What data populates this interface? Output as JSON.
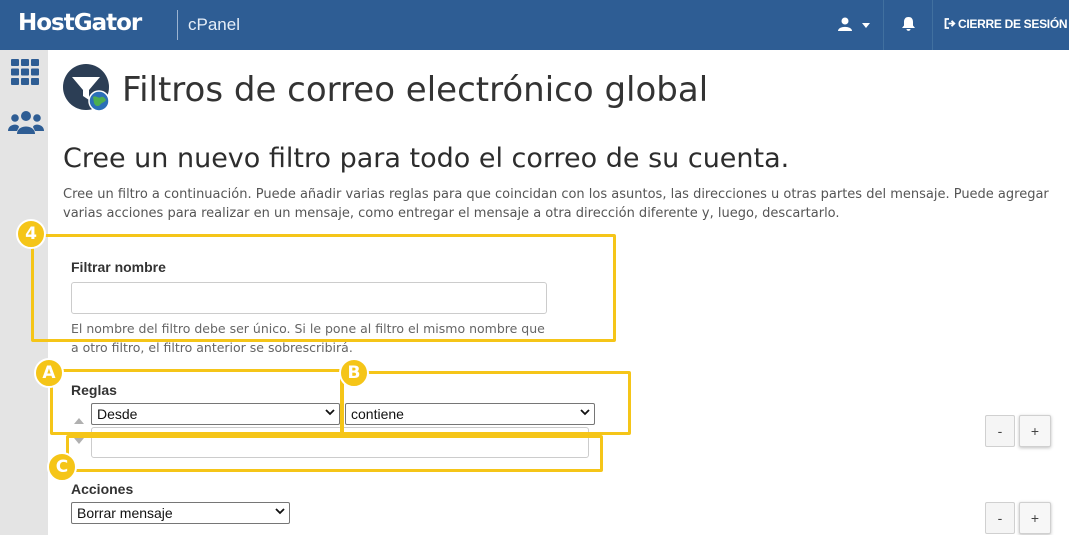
{
  "header": {
    "logo": "HostGator",
    "product": "cPanel",
    "logout_label": "CIERRE DE SESIÓN"
  },
  "icons": {
    "sidebar": [
      "grid-icon",
      "users-icon"
    ],
    "page": "filter-globe-icon",
    "header": [
      "user-icon",
      "chevron-down-icon",
      "bell-icon",
      "logout-icon"
    ]
  },
  "page": {
    "title": "Filtros de correo electrónico global",
    "section_title": "Cree un nuevo filtro para todo el correo de su cuenta.",
    "description": "Cree un filtro a continuación. Puede añadir varias reglas para que coincidan con los asuntos, las direcciones u otras partes del mensaje. Puede agregar varias acciones para realizar en un mensaje, como entregar el mensaje a otra dirección diferente y, luego, descartarlo."
  },
  "form": {
    "filter_name_label": "Filtrar nombre",
    "filter_name_value": "",
    "filter_name_help": "El nombre del filtro debe ser único. Si le pone al filtro el mismo nombre que a otro filtro, el filtro anterior se sobrescribirá.",
    "rules_label": "Reglas",
    "rule_field_selected": "Desde",
    "rule_operator_selected": "contiene",
    "rule_value": "",
    "rule_remove_label": "-",
    "rule_add_label": "+",
    "actions_label": "Acciones",
    "action_selected": "Borrar mensaje",
    "action_remove_label": "-",
    "action_add_label": "+"
  },
  "annotations": {
    "badge_4": "4",
    "badge_a": "A",
    "badge_b": "B",
    "badge_c": "C"
  },
  "colors": {
    "header_bg": "#2e5d94",
    "sidebar_bg": "#e4e4e4",
    "highlight": "#f5c518",
    "sidebar_icon": "#2e5d94"
  }
}
